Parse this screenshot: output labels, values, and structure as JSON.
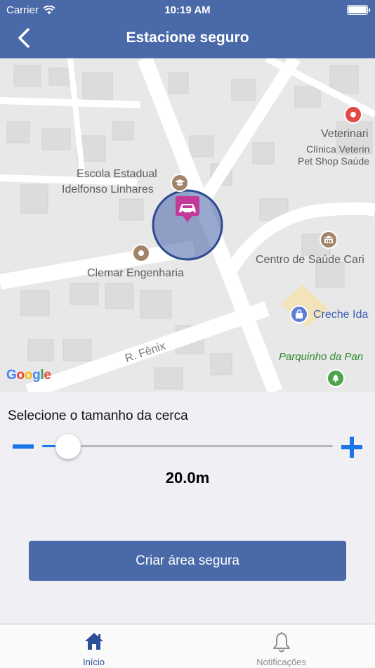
{
  "status_bar": {
    "carrier": "Carrier",
    "time": "10:19 AM"
  },
  "nav": {
    "title": "Estacione seguro",
    "back_icon": "chevron-left-icon"
  },
  "map": {
    "labels": {
      "school_line1": "Escola Estadual",
      "school_line2": "Idelfonso Linhares",
      "vet_line1": "Veterinari",
      "vet_line2": "Clínica Veterin",
      "vet_line3": "Pet Shop Saúde",
      "health_center": "Centro de Saúde Cari",
      "company": "Clemar Engenharia",
      "daycare": "Creche Ida",
      "park": "Parquinho da Pan",
      "street": "R. Fênix",
      "google": [
        "G",
        "o",
        "o",
        "g",
        "l",
        "e"
      ]
    },
    "colors": {
      "header": "#4a69a8",
      "accent": "#1a76e8",
      "marker": "#c2399a",
      "park_text": "#2e8b2e",
      "daycare_text": "#3e5fb6"
    }
  },
  "fence": {
    "label": "Selecione o tamanho da cerca",
    "value_text": "20.0m",
    "slider_fraction": 0.09,
    "minus_icon": "minus-icon",
    "plus_icon": "plus-icon"
  },
  "actions": {
    "create_label": "Criar área segura"
  },
  "tabs": [
    {
      "label": "Início",
      "icon": "home-icon",
      "active": true,
      "color": "#2b4f99"
    },
    {
      "label": "Notificações",
      "icon": "bell-icon",
      "active": false,
      "color": "#8e8e93"
    }
  ]
}
